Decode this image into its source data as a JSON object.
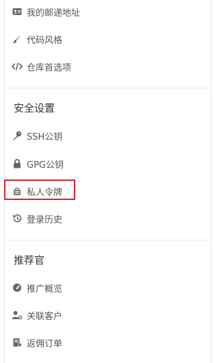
{
  "menu": {
    "account_items": [
      {
        "label": "我的邮递地址",
        "icon": "address-card-icon"
      },
      {
        "label": "代码风格",
        "icon": "paintbrush-icon"
      },
      {
        "label": "仓库首选项",
        "icon": "code-icon"
      }
    ],
    "security": {
      "title": "安全设置",
      "items": [
        {
          "label": "SSH公钥",
          "icon": "key-icon"
        },
        {
          "label": "GPG公钥",
          "icon": "lock-icon"
        },
        {
          "label": "私人令牌",
          "icon": "token-icon",
          "highlighted": true
        },
        {
          "label": "登录历史",
          "icon": "history-icon"
        }
      ]
    },
    "referral": {
      "title": "推荐官",
      "items": [
        {
          "label": "推广概览",
          "icon": "gauge-icon"
        },
        {
          "label": "关联客户",
          "icon": "linked-user-icon"
        },
        {
          "label": "返佣订单",
          "icon": "receipt-icon"
        }
      ]
    }
  },
  "colors": {
    "highlight_border": "#d6232c",
    "text": "#555555",
    "title": "#333333",
    "divider": "#ececec"
  }
}
